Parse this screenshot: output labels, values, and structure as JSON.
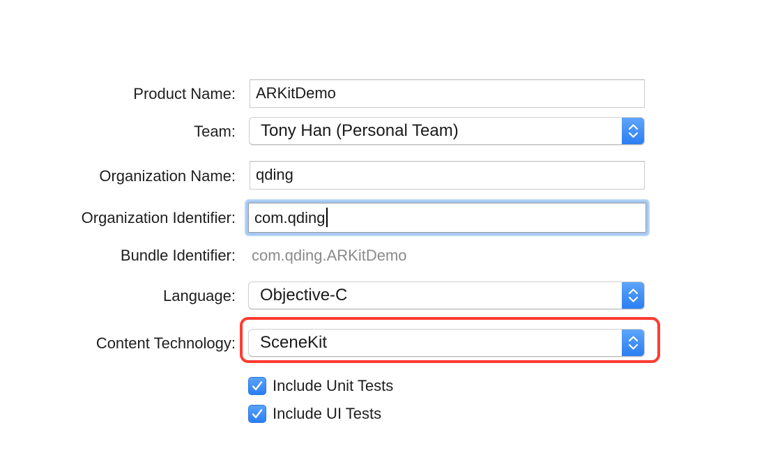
{
  "form": {
    "product_name": {
      "label": "Product Name:",
      "value": "ARKitDemo"
    },
    "team": {
      "label": "Team:",
      "value": "Tony Han (Personal Team)"
    },
    "organization_name": {
      "label": "Organization Name:",
      "value": "qding"
    },
    "organization_identifier": {
      "label": "Organization Identifier:",
      "value": "com.qding"
    },
    "bundle_identifier": {
      "label": "Bundle Identifier:",
      "value": "com.qding.ARKitDemo"
    },
    "language": {
      "label": "Language:",
      "value": "Objective-C"
    },
    "content_technology": {
      "label": "Content Technology:",
      "value": "SceneKit"
    },
    "include_unit_tests": {
      "label": "Include Unit Tests",
      "checked": true
    },
    "include_ui_tests": {
      "label": "Include UI Tests",
      "checked": true
    }
  },
  "icons": {
    "popup_stepper": "chevron-up-down-icon",
    "checkbox": "checkmark-icon"
  },
  "colors": {
    "accent": "#2a7ef2",
    "focus_ring": "#a3c8f3",
    "highlight": "#ff3b30",
    "secondary_text": "#8a8a8a"
  }
}
